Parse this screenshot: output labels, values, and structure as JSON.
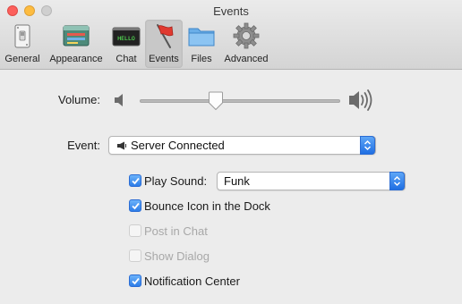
{
  "window": {
    "title": "Events"
  },
  "toolbar": {
    "items": [
      {
        "label": "General",
        "icon": "switch-icon",
        "selected": false
      },
      {
        "label": "Appearance",
        "icon": "appearance-window-icon",
        "selected": false
      },
      {
        "label": "Chat",
        "icon": "terminal-icon",
        "screen_text": "HELLO",
        "selected": false
      },
      {
        "label": "Events",
        "icon": "flag-icon",
        "selected": true
      },
      {
        "label": "Files",
        "icon": "folder-icon",
        "selected": false
      },
      {
        "label": "Advanced",
        "icon": "gear-icon",
        "selected": false
      }
    ]
  },
  "volume": {
    "label": "Volume:",
    "level": 0.37
  },
  "event": {
    "label": "Event:",
    "selected": "Server Connected"
  },
  "options": [
    {
      "label": "Play Sound:",
      "checked": true,
      "enabled": true
    },
    {
      "label": "Bounce Icon in the Dock",
      "checked": true,
      "enabled": true
    },
    {
      "label": "Post in Chat",
      "checked": false,
      "enabled": false
    },
    {
      "label": "Show Dialog",
      "checked": false,
      "enabled": false
    },
    {
      "label": "Notification Center",
      "checked": true,
      "enabled": true
    }
  ],
  "sound": {
    "selected": "Funk"
  },
  "colors": {
    "accent": "#2d7de8",
    "close": "#fc605c",
    "minimize": "#fdbc40"
  }
}
